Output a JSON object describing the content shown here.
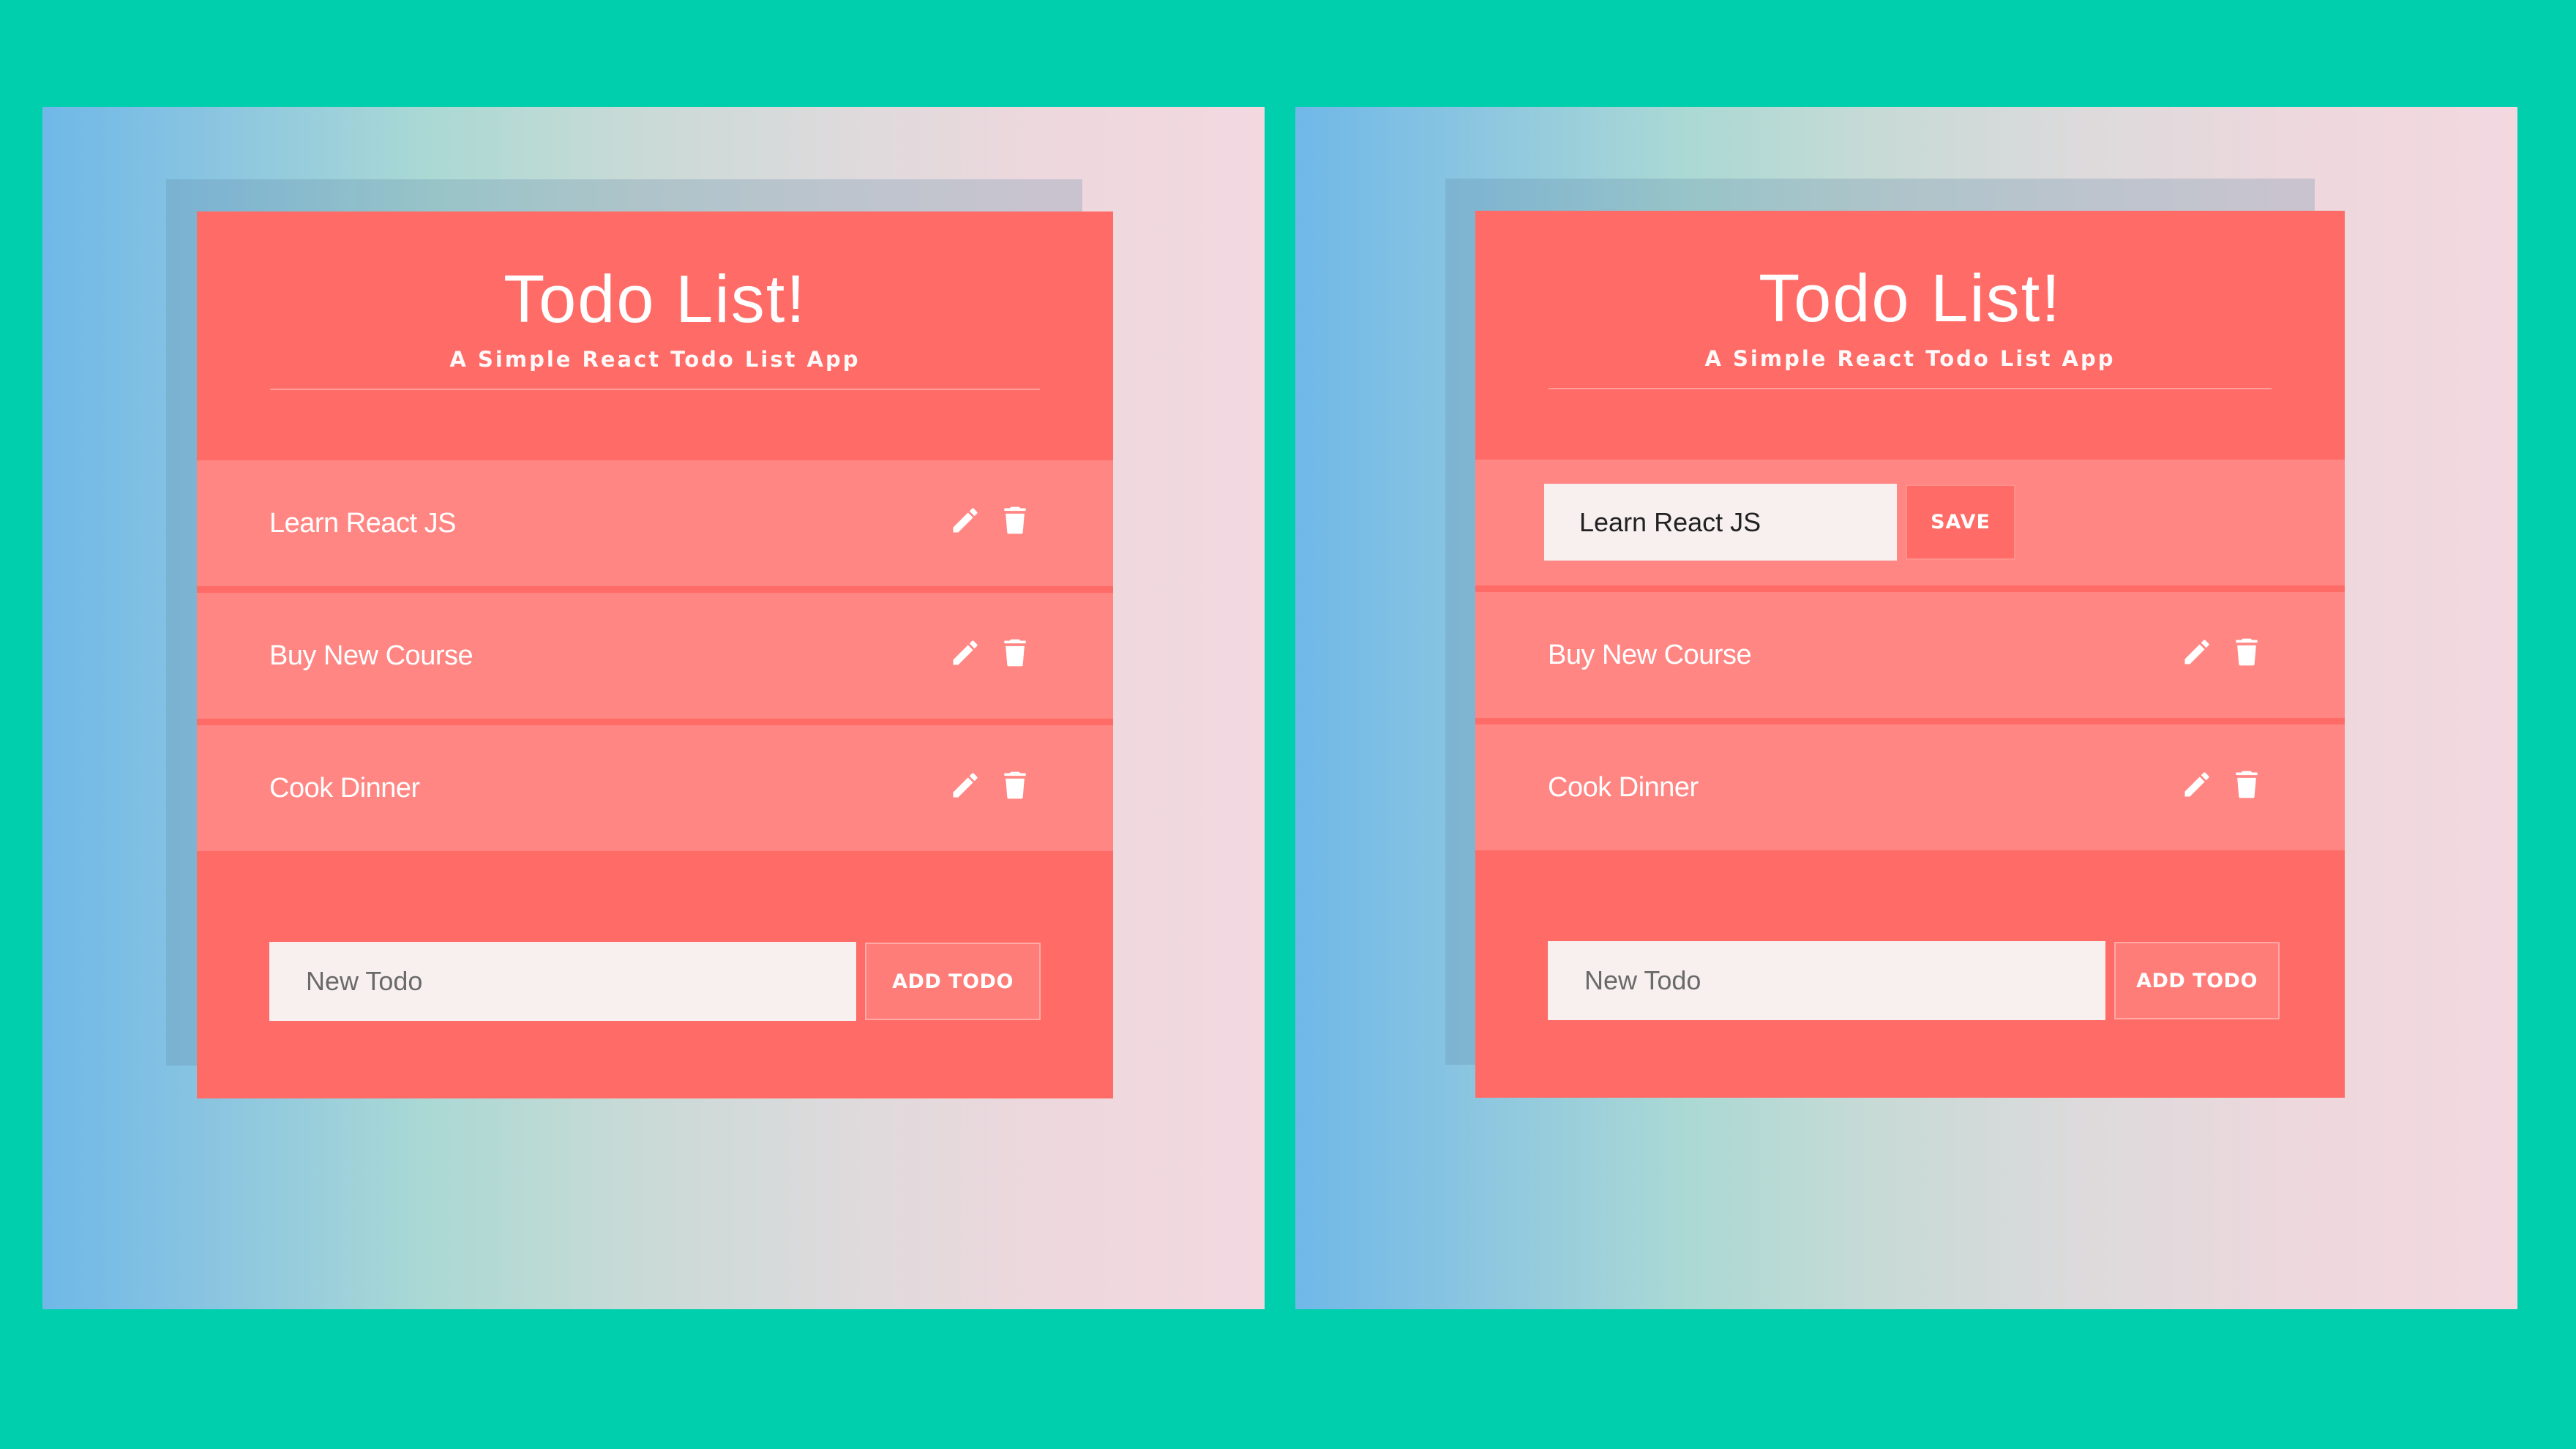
{
  "colors": {
    "background": "#00CFAE",
    "card": "#FF6B66",
    "todo_item": "#FF8683",
    "input_bg": "#F7F0EF"
  },
  "screens": [
    {
      "title": "Todo List!",
      "subtitle": "A Simple React Todo List App",
      "todos": [
        {
          "text": "Learn React JS",
          "editing": false
        },
        {
          "text": "Buy New Course",
          "editing": false
        },
        {
          "text": "Cook Dinner",
          "editing": false
        }
      ],
      "new_todo_placeholder": "New Todo",
      "add_button_label": "ADD TODO",
      "icons": {
        "edit": "pencil-icon",
        "delete": "trash-icon"
      }
    },
    {
      "title": "Todo List!",
      "subtitle": "A Simple React Todo List App",
      "edit_value": "Learn React JS",
      "save_button_label": "SAVE",
      "todos": [
        {
          "text": "Learn React JS",
          "editing": true
        },
        {
          "text": "Buy New Course",
          "editing": false
        },
        {
          "text": "Cook Dinner",
          "editing": false
        }
      ],
      "new_todo_placeholder": "New Todo",
      "add_button_label": "ADD TODO",
      "icons": {
        "edit": "pencil-icon",
        "delete": "trash-icon"
      }
    }
  ]
}
